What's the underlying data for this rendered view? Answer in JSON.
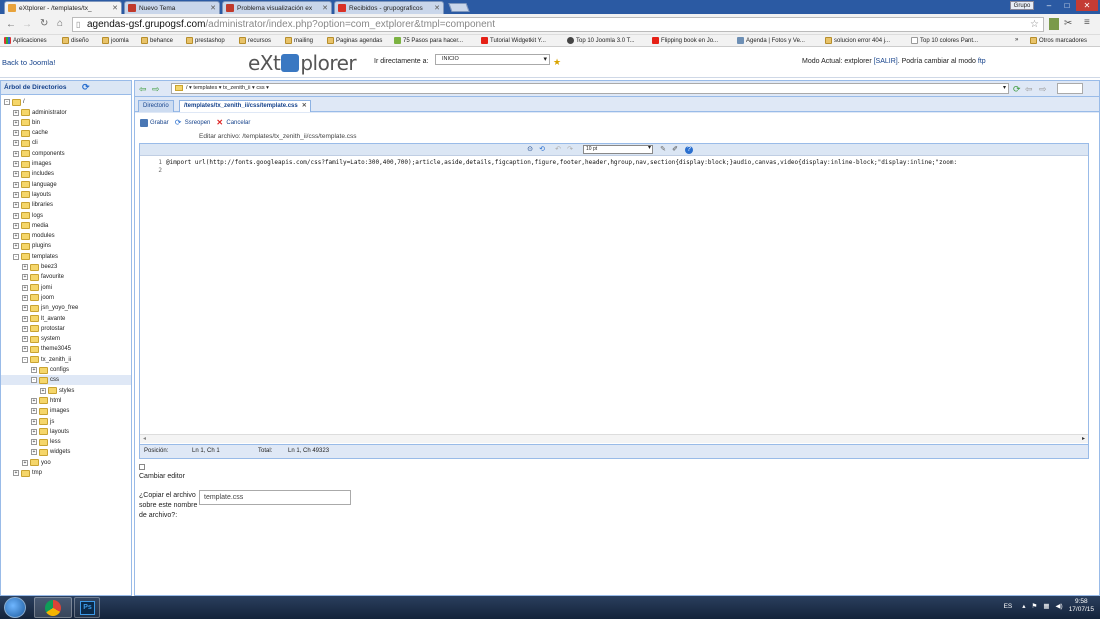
{
  "browser": {
    "tabs": [
      {
        "title": "eXtplorer - /templates/tx_",
        "active": true,
        "color": "#e8a33c"
      },
      {
        "title": "Nuevo Tema",
        "active": false,
        "color": "#c0392b"
      },
      {
        "title": "Problema visualización ex",
        "active": false,
        "color": "#c0392b"
      },
      {
        "title": "Recibidos - grupograficos",
        "active": false,
        "color": "#d93025"
      }
    ],
    "user_label": "Grupo",
    "url_domain": "agendas-gsf.grupogsf.com",
    "url_rest": "/administrator/index.php?option=com_extplorer&tmpl=component",
    "bookmarks": [
      {
        "label": "Aplicaciones",
        "icon": "apps-icon"
      },
      {
        "label": "diseño",
        "icon": "folder-icon"
      },
      {
        "label": "joomla",
        "icon": "folder-icon"
      },
      {
        "label": "behance",
        "icon": "folder-icon"
      },
      {
        "label": "prestashop",
        "icon": "folder-icon"
      },
      {
        "label": "recursos",
        "icon": "folder-icon"
      },
      {
        "label": "mailing",
        "icon": "folder-icon"
      },
      {
        "label": "Paginas agendas",
        "icon": "folder-icon"
      },
      {
        "label": "75 Pasos para hacer...",
        "icon": "page-icon"
      },
      {
        "label": "Tutorial Widgetkit Y...",
        "icon": "youtube-icon"
      },
      {
        "label": "Top 10 Joomla 3.0 T...",
        "icon": "page-icon"
      },
      {
        "label": "Flipping book en Jo...",
        "icon": "youtube-icon"
      },
      {
        "label": "Agenda | Fotos y Ve...",
        "icon": "page-icon"
      },
      {
        "label": "solucion error 404 j...",
        "icon": "folder-icon"
      },
      {
        "label": "Top 10 colores Pant...",
        "icon": "page-icon"
      }
    ],
    "bookmarks_more": "»",
    "other_bookmarks": "Otros marcadores"
  },
  "header": {
    "back_link": "Back to Joomla!",
    "logo_left": "eXt",
    "logo_right": "plorer",
    "goto_label": "Ir directamente a:",
    "goto_value": "INICIO",
    "mode_prefix": "Modo Actual: extplorer",
    "mode_salir": "[SALIR]",
    "mode_middle": ". Podría cambiar al modo",
    "mode_ftp": "ftp"
  },
  "sidebar": {
    "title": "Árbol de Directorios",
    "root": "/",
    "tree": [
      {
        "label": "administrator",
        "level": 1,
        "toggle": "+"
      },
      {
        "label": "bin",
        "level": 1,
        "toggle": "+"
      },
      {
        "label": "cache",
        "level": 1,
        "toggle": "+"
      },
      {
        "label": "cli",
        "level": 1,
        "toggle": "+"
      },
      {
        "label": "components",
        "level": 1,
        "toggle": "+"
      },
      {
        "label": "images",
        "level": 1,
        "toggle": "+"
      },
      {
        "label": "includes",
        "level": 1,
        "toggle": "+"
      },
      {
        "label": "language",
        "level": 1,
        "toggle": "+"
      },
      {
        "label": "layouts",
        "level": 1,
        "toggle": "+"
      },
      {
        "label": "libraries",
        "level": 1,
        "toggle": "+"
      },
      {
        "label": "logs",
        "level": 1,
        "toggle": "+"
      },
      {
        "label": "media",
        "level": 1,
        "toggle": "+"
      },
      {
        "label": "modules",
        "level": 1,
        "toggle": "+"
      },
      {
        "label": "plugins",
        "level": 1,
        "toggle": "+"
      },
      {
        "label": "templates",
        "level": 1,
        "toggle": "-"
      },
      {
        "label": "beez3",
        "level": 2,
        "toggle": "+"
      },
      {
        "label": "favourite",
        "level": 2,
        "toggle": "+"
      },
      {
        "label": "jomi",
        "level": 2,
        "toggle": "+"
      },
      {
        "label": "joom",
        "level": 2,
        "toggle": "+"
      },
      {
        "label": "jsn_yoyo_free",
        "level": 2,
        "toggle": "+"
      },
      {
        "label": "lt_avante",
        "level": 2,
        "toggle": "+"
      },
      {
        "label": "protostar",
        "level": 2,
        "toggle": "+"
      },
      {
        "label": "system",
        "level": 2,
        "toggle": "+"
      },
      {
        "label": "theme3045",
        "level": 2,
        "toggle": "+"
      },
      {
        "label": "tx_zenith_ii",
        "level": 2,
        "toggle": "-"
      },
      {
        "label": "configs",
        "level": 3,
        "toggle": "+"
      },
      {
        "label": "css",
        "level": 3,
        "toggle": "-",
        "selected": true
      },
      {
        "label": "styles",
        "level": 4,
        "toggle": "+"
      },
      {
        "label": "html",
        "level": 3,
        "toggle": "+"
      },
      {
        "label": "images",
        "level": 3,
        "toggle": "+"
      },
      {
        "label": "js",
        "level": 3,
        "toggle": "+"
      },
      {
        "label": "layouts",
        "level": 3,
        "toggle": "+"
      },
      {
        "label": "less",
        "level": 3,
        "toggle": "+"
      },
      {
        "label": "widgets",
        "level": 3,
        "toggle": "+"
      },
      {
        "label": "yoo",
        "level": 2,
        "toggle": "+"
      },
      {
        "label": "tmp",
        "level": 1,
        "toggle": "+"
      }
    ]
  },
  "pathbar": {
    "crumbs": "/ ▾  templates ▾  tx_zenith_ii ▾  css ▾"
  },
  "tabs": {
    "directorio": "Directorio",
    "file": "/templates/tx_zenith_ii/css/template.css"
  },
  "editor": {
    "save": "Grabar",
    "reopen": "Ssreopen",
    "cancel": "Cancelar",
    "edit_label": "Editar archivo: /templates/tx_zenith_ii/css/template.css",
    "font_size": "10 pt",
    "line_numbers": [
      "1",
      "2"
    ],
    "code_line1": "@import url(http://fonts.googleapis.com/css?family=Lato:300,400,700);article,aside,details,figcaption,figure,footer,header,hgroup,nav,section{display:block;}audio,canvas,video{display:inline-block;\"display:inline;\"zoom:",
    "status_pos_label": "Posición:",
    "status_pos_value": "Ln 1, Ch 1",
    "status_total_label": "Total:",
    "status_total_value": "Ln 1, Ch 49323",
    "toggle_label": "Cambiar editor",
    "copy_label": "¿Copiar el archivo sobre este nombre de archivo?:",
    "copy_value": "template.css"
  },
  "taskbar": {
    "lang": "ES",
    "time": "9:58",
    "date": "17/07/15"
  }
}
